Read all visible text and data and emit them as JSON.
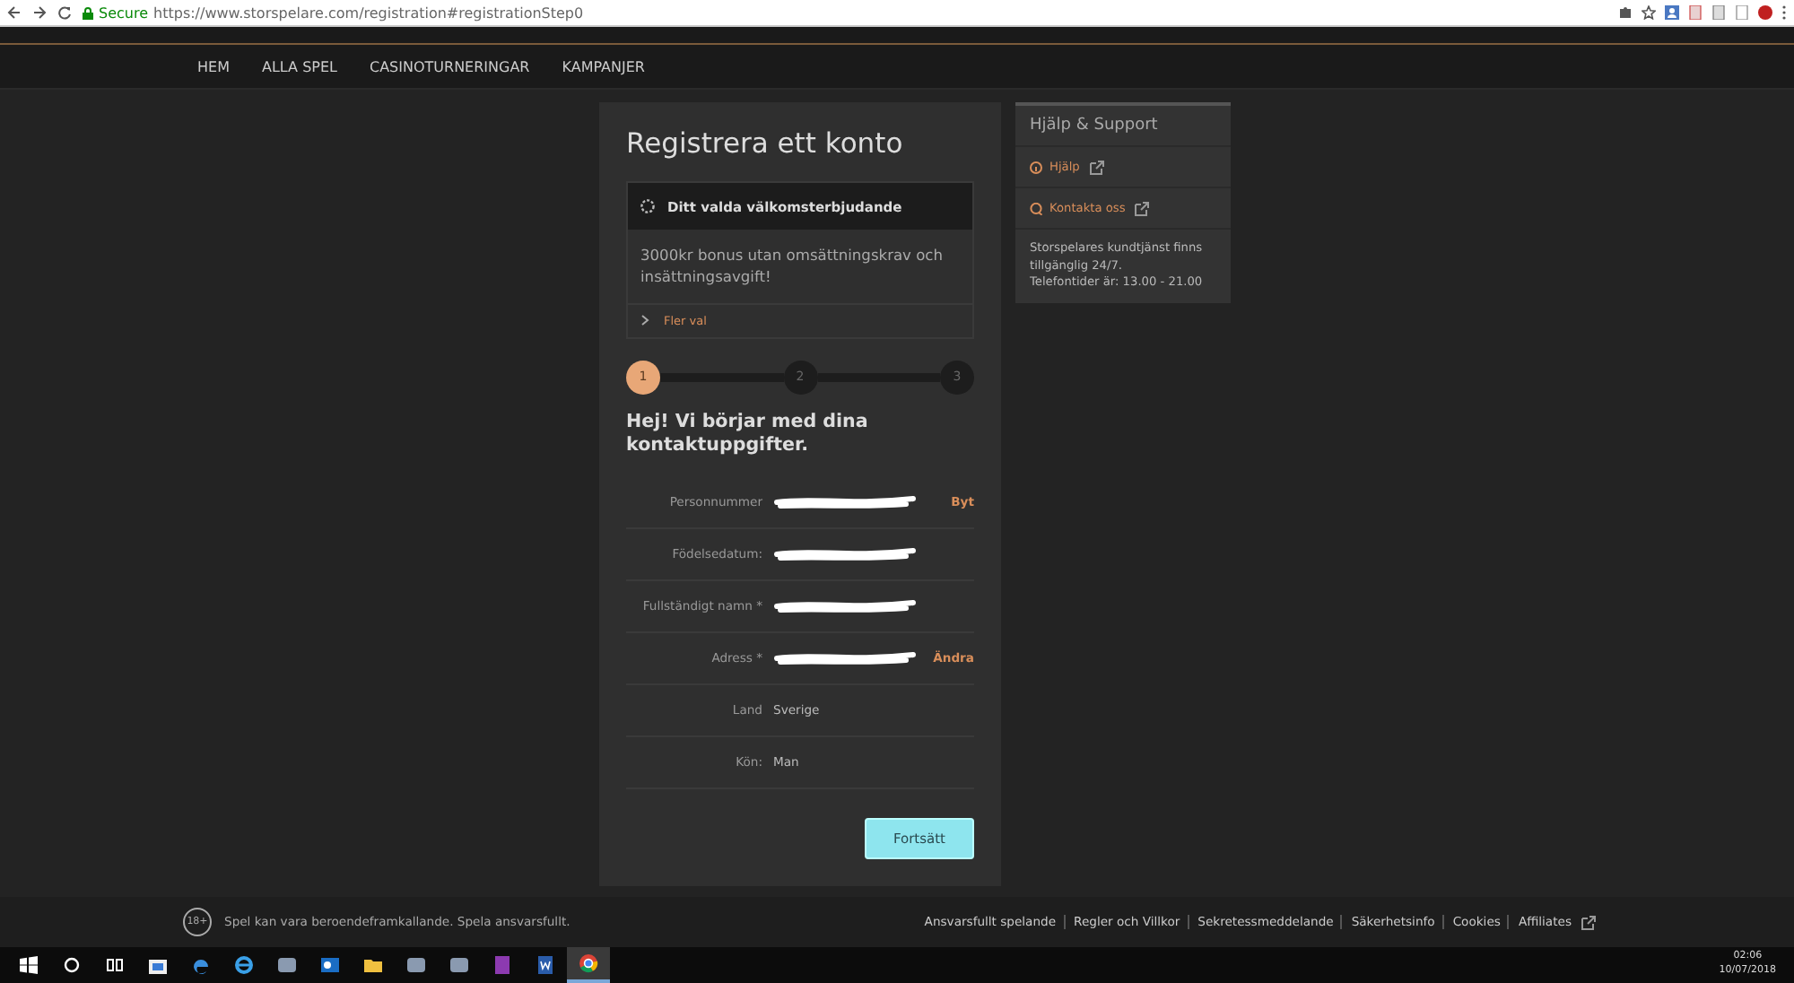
{
  "browser": {
    "secure_label": "Secure",
    "url": "https://www.storspelare.com/registration#registrationStep0"
  },
  "nav": [
    "HEM",
    "ALLA SPEL",
    "CASINOTURNERINGAR",
    "KAMPANJER"
  ],
  "registration": {
    "title": "Registrera ett konto",
    "offer": {
      "heading": "Ditt valda välkomsterbjudande",
      "text": "3000kr bonus utan omsättningskrav och insättningsavgift!",
      "more": "Fler val"
    },
    "steps": [
      {
        "label": "1",
        "selected": true
      },
      {
        "label": "2",
        "selected": false
      },
      {
        "label": "3",
        "selected": false
      }
    ],
    "heading": "Hej! Vi börjar med dina kontaktuppgifter.",
    "fields": [
      {
        "label": "Personnummer",
        "redacted": true,
        "action": "Byt"
      },
      {
        "label": "Födelsedatum:",
        "redacted": true
      },
      {
        "label": "Fullständigt namn *",
        "redacted": true
      },
      {
        "label": "Adress *",
        "redacted": true,
        "action": "Ändra"
      },
      {
        "label": "Land",
        "value": "Sverige"
      },
      {
        "label": "Kön:",
        "value": "Man"
      }
    ],
    "button": "Fortsätt"
  },
  "help": {
    "title": "Hjälp & Support",
    "links": [
      {
        "kind": "info",
        "label": "Hjälp"
      },
      {
        "kind": "chat",
        "label": "Kontakta oss"
      }
    ],
    "lines": [
      "Storspelares kundtjänst finns tillgänglig 24/7.",
      "Telefontider är: 13.00 - 21.00"
    ]
  },
  "footer": {
    "badge": "18+",
    "notice": "Spel kan vara beroendeframkallande. Spela ansvarsfullt.",
    "links": [
      {
        "label": "Ansvarsfullt spelande"
      },
      {
        "label": "Regler och Villkor"
      },
      {
        "label": "Sekretessmeddelande"
      },
      {
        "label": "Säkerhetsinfo"
      },
      {
        "label": "Cookies"
      },
      {
        "label": "Affiliates",
        "external": true
      }
    ]
  },
  "taskbar": {
    "apps": [
      {
        "kind": "store",
        "selected": false
      },
      {
        "kind": "edge",
        "selected": false
      },
      {
        "kind": "ie",
        "selected": false
      },
      {
        "kind": "app",
        "selected": false
      },
      {
        "kind": "mail",
        "selected": false
      },
      {
        "kind": "folder",
        "selected": false
      },
      {
        "kind": "app",
        "selected": false
      },
      {
        "kind": "app",
        "selected": false
      },
      {
        "kind": "note",
        "selected": false
      },
      {
        "kind": "word",
        "selected": false
      },
      {
        "kind": "chrome",
        "selected": true
      }
    ],
    "time": "02:06",
    "date": "10/07/2018"
  }
}
